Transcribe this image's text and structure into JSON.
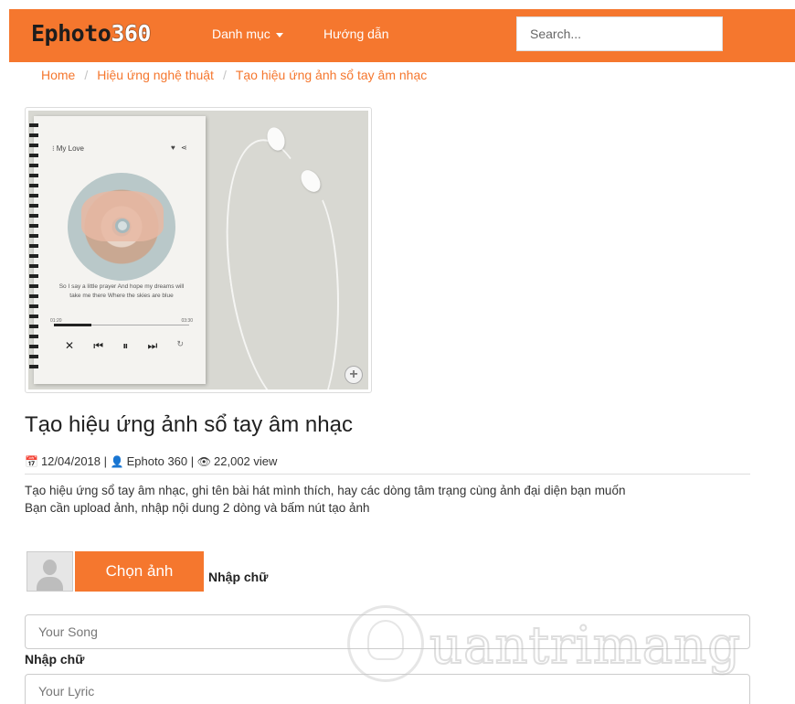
{
  "navbar": {
    "logo_text": "Ephoto",
    "logo_num": "360",
    "menu_label": "Danh mục",
    "guide_label": "Hướng dẫn",
    "search_placeholder": "Search..."
  },
  "breadcrumb": {
    "home": "Home",
    "category": "Hiệu ứng nghệ thuật",
    "current": "Tạo hiệu ứng ảnh sổ tay âm nhạc",
    "separator": "/"
  },
  "preview": {
    "song_title": "My Love",
    "lyric": "So I say a little prayer And hope my dreams will take me there Where the skies are blue",
    "time_start": "01:20",
    "time_end": "03:30",
    "control_icons": [
      "shuffle-icon",
      "previous-icon",
      "pause-icon",
      "next-icon",
      "repeat-icon"
    ],
    "zoom_icon": "plus-circle-icon"
  },
  "page": {
    "title": "Tạo hiệu ứng ảnh sổ tay âm nhạc",
    "date": "12/04/2018",
    "author": "Ephoto 360",
    "views": "22,002 view",
    "separator": "|",
    "description_line1": "Tạo hiệu ứng sổ tay âm nhạc, ghi tên bài hát mình thích, hay các dòng tâm trạng cùng ảnh đại diện bạn muốn",
    "description_line2": "Bạn cần upload ảnh, nhập nội dung 2 dòng và bấm nút tạo ảnh"
  },
  "form": {
    "choose_button": "Chọn ảnh",
    "label_1": "Nhập chữ",
    "song_placeholder": "Your Song",
    "label_2": "Nhập chữ",
    "lyric_placeholder": "Your Lyric"
  },
  "watermark": {
    "text": "uantrimang"
  },
  "colors": {
    "accent": "#f5772e",
    "text": "#333333"
  }
}
